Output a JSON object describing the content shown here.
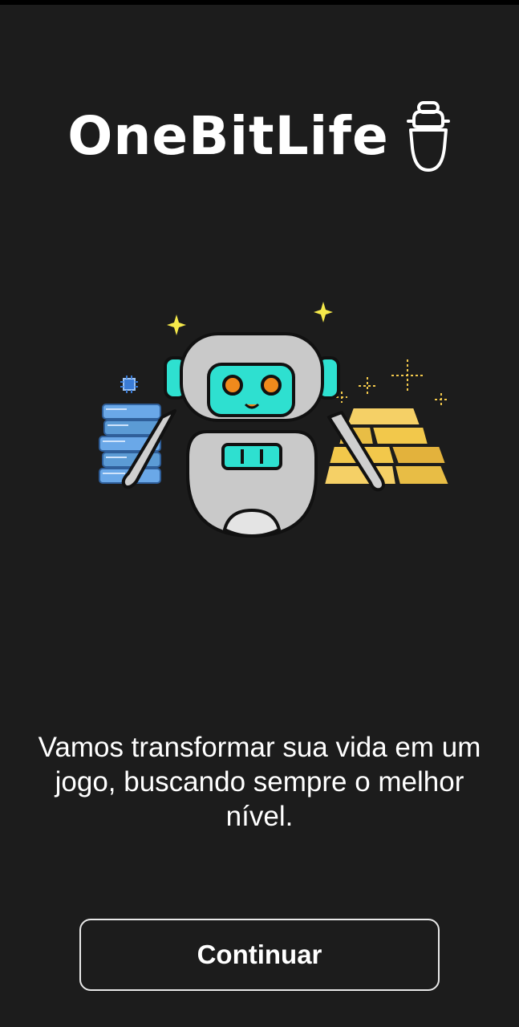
{
  "app": {
    "logo_text": "OneBitLife",
    "logo_icon": "mascot-head-icon"
  },
  "illustration": {
    "name": "robot-with-books-and-gold-illustration",
    "colors": {
      "robot_body": "#c9c9c9",
      "robot_face": "#2ee0d0",
      "robot_eyes": "#f08a1c",
      "books": "#5b9bd5",
      "gold": "#f2c84b",
      "sparkle": "#f5e94a"
    }
  },
  "tagline": "Vamos transformar sua vida em um jogo, buscando sempre o melhor nível.",
  "continue_button": {
    "label": "Continuar"
  },
  "colors": {
    "background": "#1c1c1c",
    "text": "#ffffff",
    "button_border": "#e8e8e8"
  }
}
